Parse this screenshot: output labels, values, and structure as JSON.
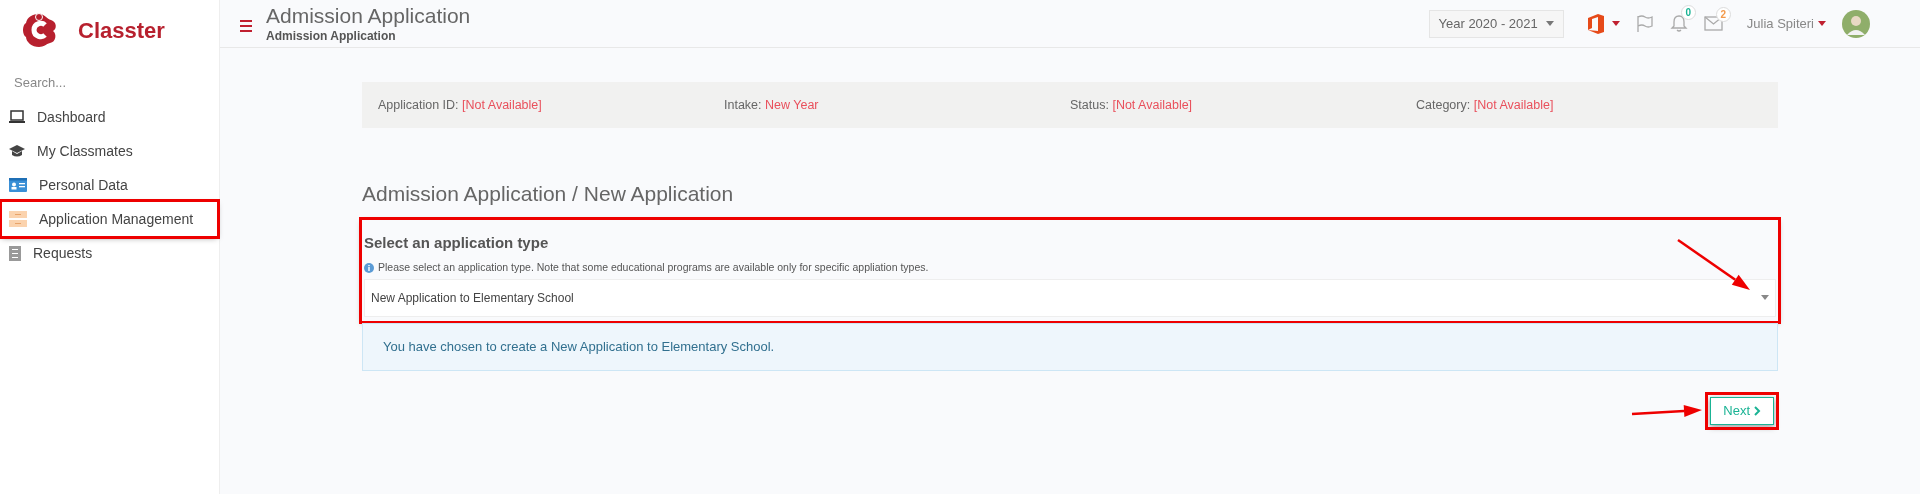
{
  "sidebar": {
    "brand": "Classter",
    "search": {
      "placeholder": "Search..."
    },
    "items": [
      {
        "kind": "laptop",
        "label": "Dashboard",
        "highlighted": false
      },
      {
        "kind": "cap",
        "label": "My Classmates",
        "highlighted": false
      },
      {
        "kind": "card",
        "label": "Personal Data",
        "highlighted": false
      },
      {
        "kind": "forms",
        "label": "Application Management",
        "highlighted": true
      },
      {
        "kind": "list",
        "label": "Requests",
        "highlighted": false
      }
    ]
  },
  "header": {
    "title": "Admission Application",
    "breadcrumb": "Admission Application",
    "year": "Year 2020 - 2021",
    "notifications": [
      {
        "kind": "bell",
        "count": "0",
        "color": "#1ab394"
      },
      {
        "kind": "mail",
        "count": "2",
        "color": "#f39a4b"
      }
    ],
    "user": "Julia Spiteri"
  },
  "info": [
    {
      "label": "Application ID:",
      "value": "[Not Available]"
    },
    {
      "label": "Intake:",
      "value": "New Year"
    },
    {
      "label": "Status:",
      "value": "[Not Available]"
    },
    {
      "label": "Category:",
      "value": "[Not Available]"
    }
  ],
  "heading": "Admission Application / New Application",
  "form": {
    "label": "Select an application type",
    "help": "Please select an application type. Note that some educational programs are available only for specific appliation types.",
    "value": "New Application to Elementary School",
    "highlighted": true,
    "arrow": true
  },
  "message": "You have chosen to create a New Application to Elementary School.",
  "next": {
    "label": "Next",
    "highlighted": true,
    "arrow": true
  }
}
